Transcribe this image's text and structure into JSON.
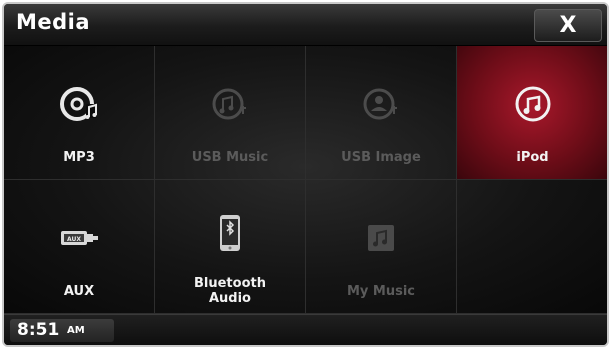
{
  "window": {
    "title": "Media",
    "close_label": "X"
  },
  "tiles": [
    {
      "label": "MP3",
      "icon": "disc-music-icon",
      "state": "enabled"
    },
    {
      "label": "USB Music",
      "icon": "usb-music-icon",
      "state": "disabled"
    },
    {
      "label": "USB Image",
      "icon": "usb-image-icon",
      "state": "disabled"
    },
    {
      "label": "iPod",
      "icon": "ipod-music-icon",
      "state": "selected"
    },
    {
      "label": "AUX",
      "icon": "aux-cable-icon",
      "state": "enabled"
    },
    {
      "label_line1": "Bluetooth",
      "label_line2": "Audio",
      "icon": "bluetooth-phone-icon",
      "state": "enabled"
    },
    {
      "label": "My Music",
      "icon": "my-music-icon",
      "state": "disabled"
    }
  ],
  "status": {
    "time": "8:51",
    "ampm": "AM"
  },
  "colors": {
    "selected_tile": "#a8182b",
    "background": "#0b0b0b",
    "disabled_text": "#5b5b5b"
  }
}
